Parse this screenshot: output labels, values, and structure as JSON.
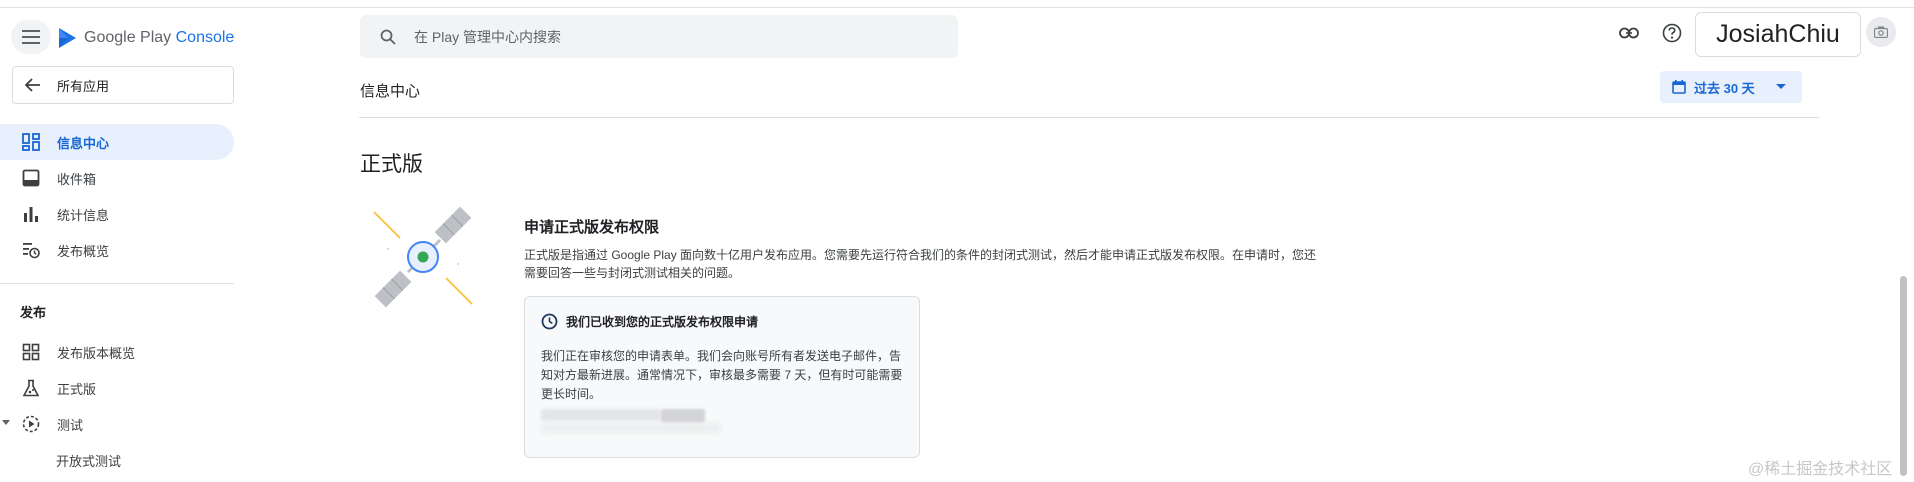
{
  "app": {
    "logo_google_play": "Google Play",
    "logo_console": "Console",
    "all_apps_label": "所有应用"
  },
  "search": {
    "placeholder": "在 Play 管理中心内搜索"
  },
  "header": {
    "username": "JosiahChiu"
  },
  "sidebar": {
    "items": [
      {
        "label": "信息中心",
        "icon": "dashboard-icon",
        "active": true
      },
      {
        "label": "收件箱",
        "icon": "inbox-icon"
      },
      {
        "label": "统计信息",
        "icon": "bar-chart-icon"
      },
      {
        "label": "发布概览",
        "icon": "release-overview-icon"
      }
    ],
    "section_heading": "发布",
    "release_items": [
      {
        "label": "发布版本概览",
        "icon": "grid-icon"
      },
      {
        "label": "正式版",
        "icon": "production-icon"
      },
      {
        "label": "测试",
        "icon": "testing-icon",
        "expanded": true
      },
      {
        "label": "开放式测试",
        "icon": ""
      }
    ]
  },
  "main": {
    "page_title": "信息中心",
    "date_range_label": "过去 30 天",
    "section_title": "正式版",
    "request_title": "申请正式版发布权限",
    "request_description": "正式版是指通过 Google Play 面向数十亿用户发布应用。您需要先运行符合我们的条件的封闭式测试，然后才能申请正式版发布权限。在申请时，您还需要回答一些与封闭式测试相关的问题。",
    "status_card": {
      "title": "我们已收到您的正式版发布权限申请",
      "body": "我们正在审核您的申请表单。我们会向账号所有者发送电子邮件，告知对方最新进展。通常情况下，审核最多需要 7 天，但有时可能需要更长时间。"
    }
  },
  "watermark": "@稀土掘金技术社区",
  "colors": {
    "accent": "#1a73e8",
    "active_bg": "#e8f0fe",
    "active_text": "#1967d2",
    "card_bg": "#f8f9fa"
  }
}
